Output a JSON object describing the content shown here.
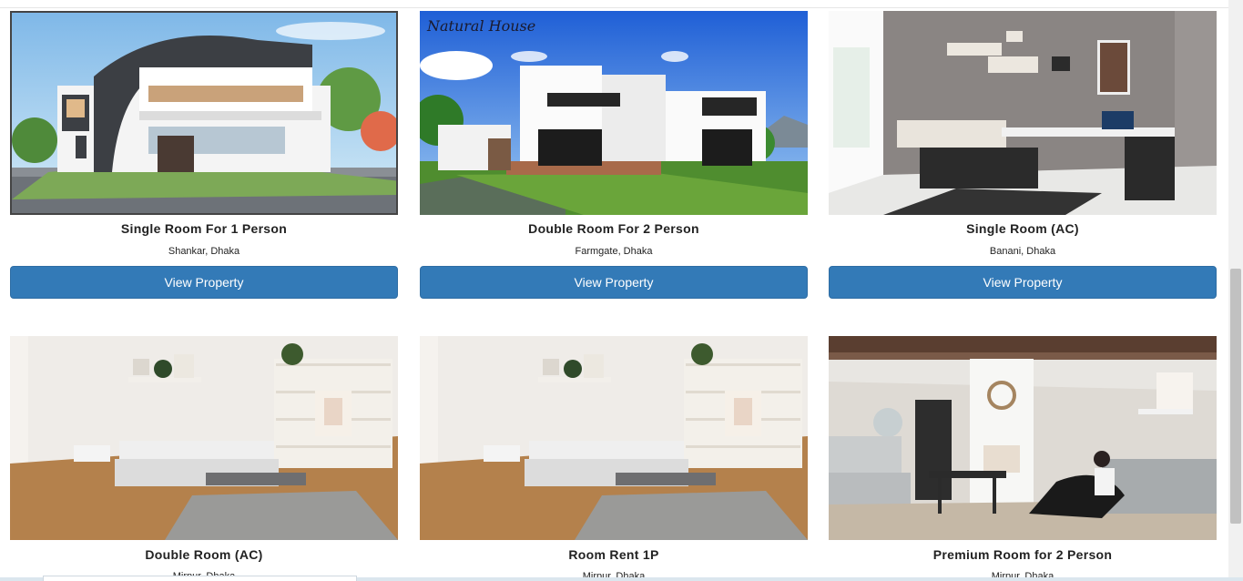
{
  "listings": [
    {
      "title": "Single Room For 1 Person",
      "location": "Shankar, Dhaka",
      "button": "View Property",
      "image": "modern-villa-photo"
    },
    {
      "title": "Double Room For 2 Person",
      "location": "Farmgate, Dhaka",
      "button": "View Property",
      "image": "white-house-photo",
      "image_text": "Natural House"
    },
    {
      "title": "Single Room (AC)",
      "location": "Banani, Dhaka",
      "button": "View Property",
      "image": "bedroom-desk-photo"
    },
    {
      "title": "Double Room (AC)",
      "location": "Mirpur, Dhaka",
      "image": "bedroom-shelves-photo"
    },
    {
      "title": "Room Rent 1P",
      "location": "Mirpur, Dhaka",
      "image": "bedroom-shelves-photo"
    },
    {
      "title": "Premium Room for 2 Person",
      "location": "Mirpur, Dhaka",
      "image": "loft-living-room-photo"
    }
  ],
  "colors": {
    "button": "#337ab7",
    "button_text": "#ffffff",
    "title": "#222222"
  }
}
